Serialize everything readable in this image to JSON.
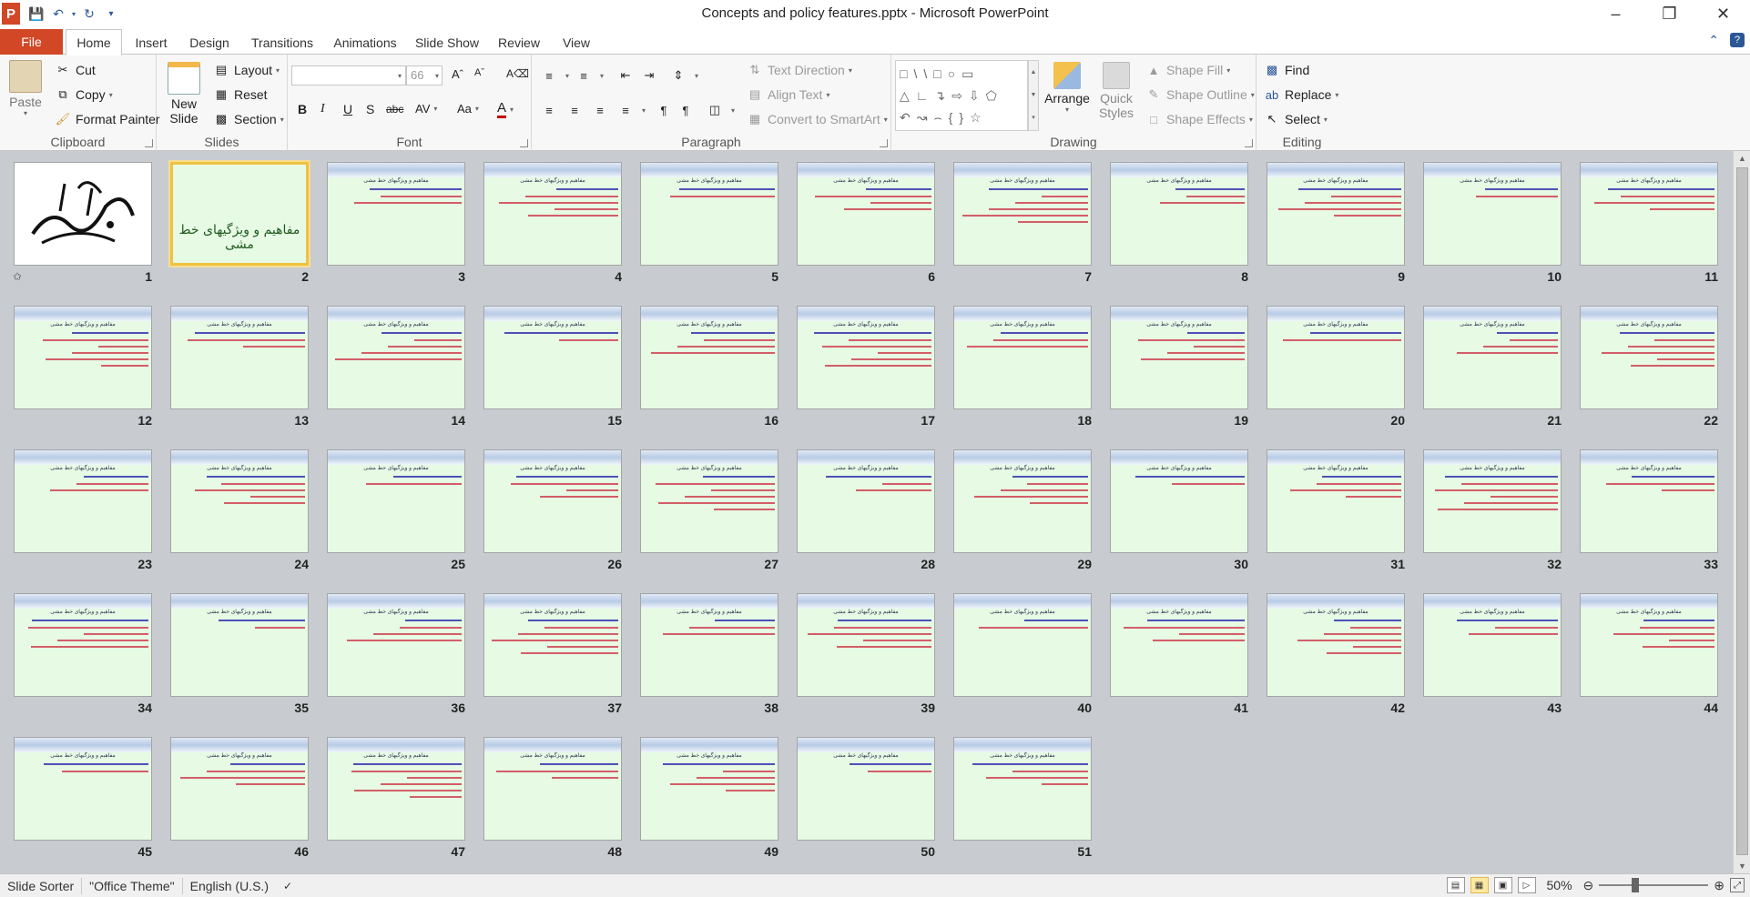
{
  "window": {
    "title": "Concepts and policy features.pptx - Microsoft PowerPoint",
    "app_icon": "P",
    "controls": [
      "minimize-icon",
      "restore-icon",
      "close-icon"
    ]
  },
  "ribbon_tabs": {
    "file": "File",
    "items": [
      "Home",
      "Insert",
      "Design",
      "Transitions",
      "Animations",
      "Slide Show",
      "Review",
      "View"
    ],
    "active": "Home"
  },
  "clipboard": {
    "paste": "Paste",
    "cut": "Cut",
    "copy": "Copy",
    "format_painter": "Format Painter",
    "label": "Clipboard"
  },
  "slides_group": {
    "new_slide_1": "New",
    "new_slide_2": "Slide",
    "layout": "Layout",
    "reset": "Reset",
    "section": "Section",
    "label": "Slides"
  },
  "font_group": {
    "font_name": "",
    "font_size": "66",
    "label": "Font",
    "buttons": [
      "B",
      "I",
      "U",
      "S",
      "abc",
      "AV",
      "Aa",
      "A"
    ]
  },
  "paragraph_group": {
    "text_direction": "Text Direction",
    "align_text": "Align Text",
    "convert_smartart": "Convert to SmartArt",
    "label": "Paragraph"
  },
  "drawing_group": {
    "arrange": "Arrange",
    "quick_styles_1": "Quick",
    "quick_styles_2": "Styles",
    "shape_fill": "Shape Fill",
    "shape_outline": "Shape Outline",
    "shape_effects": "Shape Effects",
    "label": "Drawing"
  },
  "editing_group": {
    "find": "Find",
    "replace": "Replace",
    "select": "Select",
    "label": "Editing"
  },
  "slide_sorter": {
    "selected_slide": 2,
    "slide2_title": "مفاهیم و ویژگیهای خط مشی",
    "slide_header_text": "مفاهیم و ویژگیهای خط مشی",
    "numbers": [
      "1",
      "2",
      "3",
      "4",
      "5",
      "6",
      "7",
      "8",
      "9",
      "10",
      "11",
      "12",
      "13",
      "14",
      "15",
      "16",
      "17",
      "18",
      "19",
      "20",
      "21",
      "22",
      "23",
      "24",
      "25",
      "26",
      "27",
      "28",
      "29",
      "30",
      "31",
      "32",
      "33",
      "34",
      "35",
      "36",
      "37",
      "38",
      "39",
      "40",
      "41",
      "42",
      "43",
      "44",
      "45",
      "46",
      "47",
      "48",
      "49",
      "50",
      "51"
    ]
  },
  "status": {
    "view": "Slide Sorter",
    "theme": "\"Office Theme\"",
    "language": "English (U.S.)",
    "zoom": "50%"
  }
}
